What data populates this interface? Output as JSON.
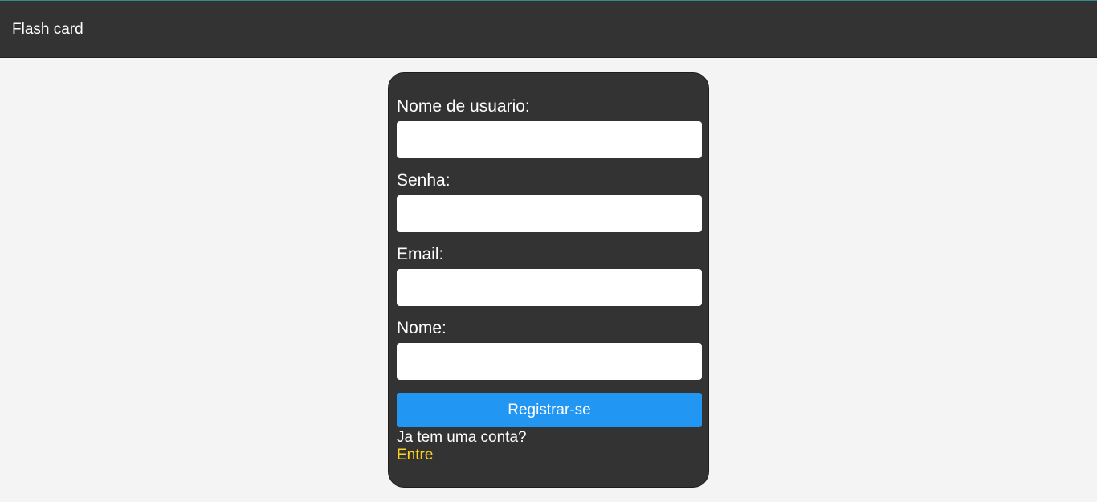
{
  "header": {
    "brand": "Flash card"
  },
  "form": {
    "username_label": "Nome de usuario:",
    "username_value": "",
    "password_label": "Senha:",
    "password_value": "",
    "email_label": "Email:",
    "email_value": "",
    "name_label": "Nome:",
    "name_value": "",
    "submit_label": "Registrar-se",
    "login_prompt": "Ja tem uma conta?",
    "login_link": "Entre"
  },
  "colors": {
    "header_bg": "#333333",
    "card_bg": "#333333",
    "page_bg": "#f4f4f4",
    "button_bg": "#2196f3",
    "link_color": "#ffd21f"
  }
}
